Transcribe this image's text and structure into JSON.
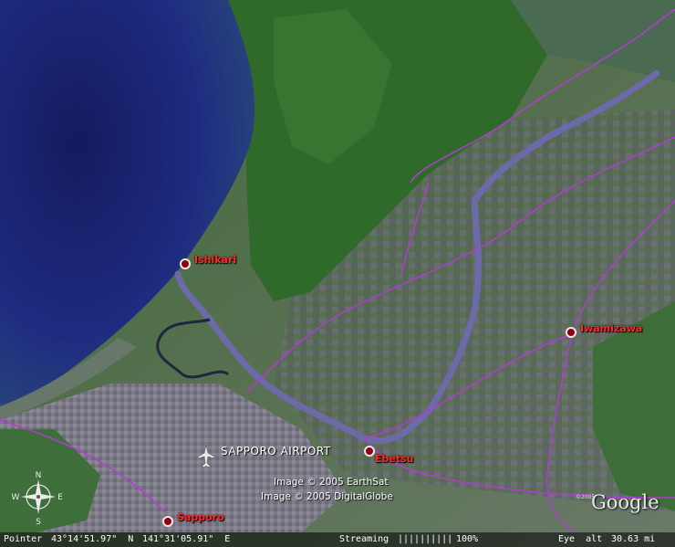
{
  "map": {
    "colors": {
      "water": "#1c2a78",
      "land": "#4c6a4e",
      "forest": "#2f6a2a",
      "urban": "#7e7d8a",
      "roads": "#b23bd6",
      "river": "#6c6aa8",
      "city_marker": "#8b0012",
      "city_label": "#ff2a2a"
    },
    "places": [
      {
        "name": "Ishikari"
      },
      {
        "name": "Iwamizawa"
      },
      {
        "name": "Ebetsu"
      },
      {
        "name": "Sapporo"
      }
    ],
    "airport": {
      "name": "SAPPORO AIRPORT",
      "icon": "airplane-icon"
    },
    "credits": [
      "Image © 2005 EarthSat",
      "Image © 2005 DigitalGlobe"
    ],
    "logo": "Google",
    "logo_copyright": "©2005",
    "compass": {
      "north": "N",
      "south": "S",
      "east": "E",
      "west": "W"
    }
  },
  "status": {
    "pointer_label": "Pointer",
    "latitude": "43°14'51.97\"  N",
    "longitude": "141°31'05.91\"  E",
    "streaming_label": "Streaming",
    "streaming_bar": "||||||||||",
    "streaming_percent": "100%",
    "eye_alt_label": "Eye  alt",
    "eye_alt_value": "30.63 mi"
  }
}
